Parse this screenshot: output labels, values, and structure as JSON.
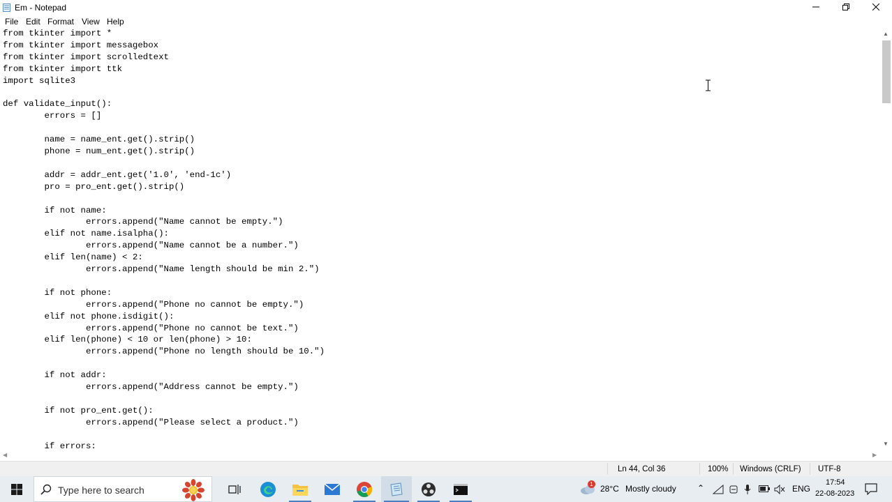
{
  "window": {
    "title": "Em - Notepad",
    "minimize_icon": "minimize-icon",
    "maximize_icon": "restore-icon",
    "close_icon": "close-icon"
  },
  "menu": [
    "File",
    "Edit",
    "Format",
    "View",
    "Help"
  ],
  "editor": {
    "lines": [
      "from tkinter import *",
      "from tkinter import messagebox",
      "from tkinter import scrolledtext",
      "from tkinter import ttk",
      "import sqlite3",
      "",
      "def validate_input():",
      "        errors = []",
      "",
      "        name = name_ent.get().strip()",
      "        phone = num_ent.get().strip()",
      "",
      "        addr = addr_ent.get('1.0', 'end-1c')",
      "        pro = pro_ent.get().strip()",
      "",
      "        if not name:",
      "                errors.append(\"Name cannot be empty.\")",
      "        elif not name.isalpha():",
      "                errors.append(\"Name cannot be a number.\")",
      "        elif len(name) < 2:",
      "                errors.append(\"Name length should be min 2.\")",
      "",
      "        if not phone:",
      "                errors.append(\"Phone no cannot be empty.\")",
      "        elif not phone.isdigit():",
      "                errors.append(\"Phone no cannot be text.\")",
      "        elif len(phone) < 10 or len(phone) > 10:",
      "                errors.append(\"Phone no length should be 10.\")",
      "",
      "        if not addr:",
      "                errors.append(\"Address cannot be empty.\")",
      "",
      "        if not pro_ent.get():",
      "                errors.append(\"Please select a product.\")",
      "",
      "        if errors:"
    ]
  },
  "status": {
    "position": "Ln 44, Col 36",
    "zoom": "100%",
    "line_ending": "Windows (CRLF)",
    "encoding": "UTF-8"
  },
  "taskbar": {
    "search_placeholder": "Type here to search",
    "weather_temp": "28°C",
    "weather_desc": "Mostly cloudy",
    "weather_badge": "1",
    "language": "ENG",
    "time": "17:54",
    "date": "22-08-2023",
    "apps": [
      "start-icon",
      "search-icon",
      "task-view-icon",
      "edge-icon",
      "file-explorer-icon",
      "mail-icon",
      "chrome-icon",
      "notepad-icon",
      "obs-icon",
      "terminal-icon"
    ],
    "colors": {
      "taskbar_bg": "#e8edf2",
      "active_underline": "#4a7fbf"
    }
  }
}
